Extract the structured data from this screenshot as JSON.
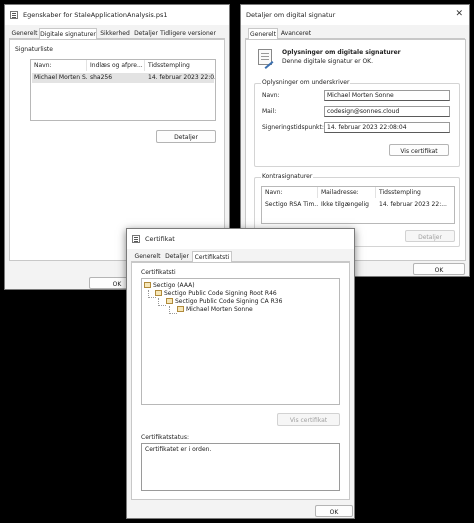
{
  "win1": {
    "title": "Egenskaber for StaleApplicationAnalysis.ps1",
    "tabs": [
      "Generelt",
      "Digitale signaturer",
      "Sikkerhed",
      "Detaljer",
      "Tidligere versioner"
    ],
    "list_label": "Signaturliste",
    "columns": [
      "Navn:",
      "Indlæs og afpre...",
      "Tidsstempling"
    ],
    "row": [
      "Michael Morten S...",
      "sha256",
      "14. februar 2023 22:0..."
    ],
    "details_button": "Detaljer",
    "ok_button": "OK"
  },
  "win2": {
    "title": "Detaljer om digital signatur",
    "tabs": [
      "Generelt",
      "Avanceret"
    ],
    "info_title": "Oplysninger om digitale signaturer",
    "info_subtitle": "Denne digitale signatur er OK.",
    "signer_group": "Oplysninger om underskriver",
    "name_label": "Navn:",
    "name_value": "Michael Morten Sonne",
    "mail_label": "Mail:",
    "mail_value": "codesign@sonnes.cloud",
    "time_label": "Signeringstidspunkt:",
    "time_value": "14. februar 2023 22:08:04",
    "view_cert_button": "Vis certifikat",
    "counter_group": "Kontrasignaturer",
    "counter_columns": [
      "Navn:",
      "Mailadresse:",
      "Tidsstempling"
    ],
    "counter_row": [
      "Sectigo RSA Tim...",
      "Ikke tilgængelig",
      "14. februar 2023 22:..."
    ],
    "counter_details_button": "Detaljer",
    "ok_button": "OK"
  },
  "win3": {
    "title": "Certifikat",
    "tabs": [
      "Generelt",
      "Detaljer",
      "Certifikatsti"
    ],
    "path_group": "Certifikatsti",
    "tree": [
      "Sectigo (AAA)",
      "Sectigo Public Code Signing Root R46",
      "Sectigo Public Code Signing CA R36",
      "Michael Morten Sonne"
    ],
    "view_cert_button": "Vis certifikat",
    "status_label": "Certifikatstatus:",
    "status_value": "Certifikatet er i orden.",
    "ok_button": "OK"
  }
}
